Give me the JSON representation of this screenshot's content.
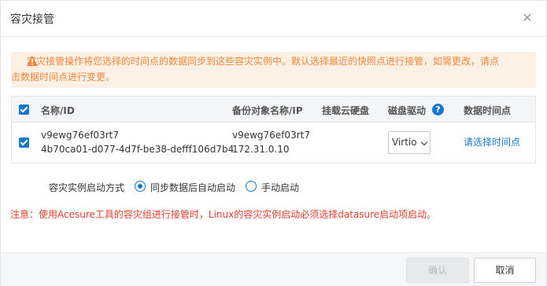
{
  "dialog": {
    "title": "容灾接管",
    "close_icon": "close-icon"
  },
  "warning": {
    "icon": "warning-triangle-icon",
    "line1": "容灾接管操作将您选择的时间点的数据同步到这些容灾实例中。默认选择最近的快照点进行接管，如需更改，请点",
    "line2": "击数据时间点进行变更。",
    "color": "#f0873a"
  },
  "table": {
    "headers": {
      "name": "名称/ID",
      "backup": "备份对象名称/IP",
      "disk": "挂载云硬盘",
      "driver": "磁盘驱动",
      "time": "数据时间点"
    },
    "rows": [
      {
        "name": "v9ewg76ef03rt7",
        "id": "4b70ca01-d077-4d7f-be38-defff106d7b4",
        "backup_name": "v9ewg76ef03rt7",
        "backup_ip": "172.31.0.10",
        "disk": "",
        "driver": "Virtio",
        "time_link": "请选择时间点",
        "checked": true
      }
    ],
    "header_checked": true
  },
  "startup": {
    "label": "容灾实例启动方式",
    "options": [
      {
        "label": "同步数据后自动启动",
        "checked": true
      },
      {
        "label": "手动启动",
        "checked": false
      }
    ]
  },
  "note": "注意：使用Acesure工具的容灾组进行接管时，Linux的容灾实例启动必须选择datasure启动项启动。",
  "footer": {
    "confirm": "确认",
    "cancel": "取消"
  },
  "colors": {
    "accent": "#1677d2",
    "warning_bg": "#fdf0e4",
    "note": "#e3402d"
  }
}
